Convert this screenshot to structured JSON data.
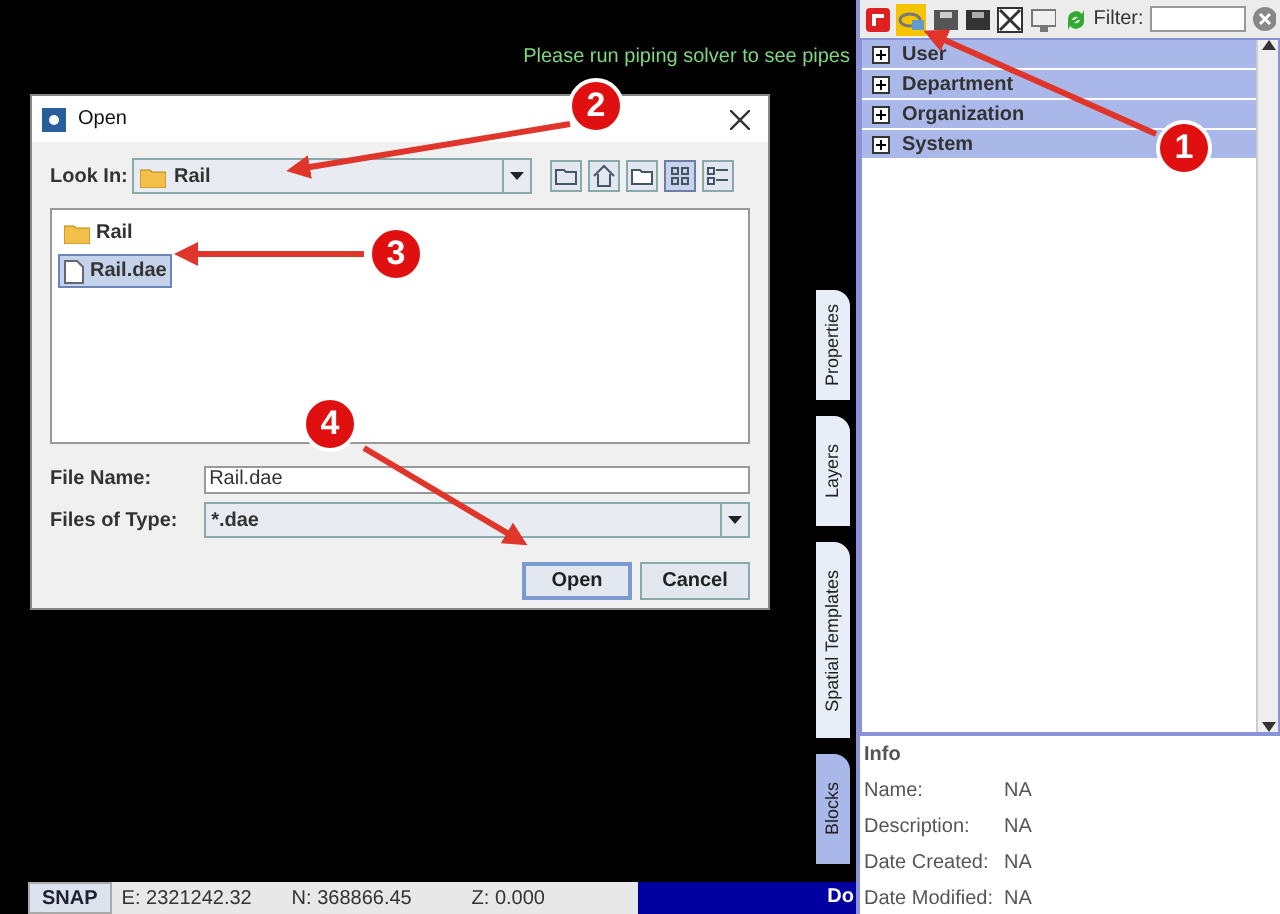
{
  "canvas_message": "Please run piping solver to see pipes",
  "dialog": {
    "title": "Open",
    "look_in": {
      "label": "Look In:",
      "value": "Rail"
    },
    "files": [
      {
        "name": "Rail",
        "kind": "folder",
        "selected": false
      },
      {
        "name": "Rail.dae",
        "kind": "file",
        "selected": true
      }
    ],
    "file_name": {
      "label": "File Name:",
      "value": "Rail.dae"
    },
    "files_of_type": {
      "label": "Files of Type:",
      "value": "*.dae"
    },
    "buttons": [
      {
        "label": "Open",
        "focused": true
      },
      {
        "label": "Cancel",
        "focused": false
      }
    ]
  },
  "side_tabs": [
    {
      "label": "Properties",
      "selected": false
    },
    {
      "label": "Layers",
      "selected": false
    },
    {
      "label": "Spatial Templates",
      "selected": false
    },
    {
      "label": "Blocks",
      "selected": true
    }
  ],
  "toolbar": {
    "filter_label": "Filter:"
  },
  "tree": [
    {
      "label": "User",
      "expanded": false
    },
    {
      "label": "Department",
      "expanded": false
    },
    {
      "label": "Organization",
      "expanded": false
    },
    {
      "label": "System",
      "expanded": false
    }
  ],
  "info": {
    "title": "Info",
    "rows": [
      {
        "label": "Name:",
        "value": "NA"
      },
      {
        "label": "Description:",
        "value": "NA"
      },
      {
        "label": "Date Created:",
        "value": "NA"
      },
      {
        "label": "Date Modified:",
        "value": "NA"
      }
    ]
  },
  "status_bar": {
    "snap": "SNAP",
    "easting": "E: 2321242.32",
    "northing": "N: 368866.45",
    "z": "Z: 0.000",
    "message": "Do"
  },
  "callouts": [
    {
      "number": "1"
    },
    {
      "number": "2"
    },
    {
      "number": "3"
    },
    {
      "number": "4"
    }
  ]
}
